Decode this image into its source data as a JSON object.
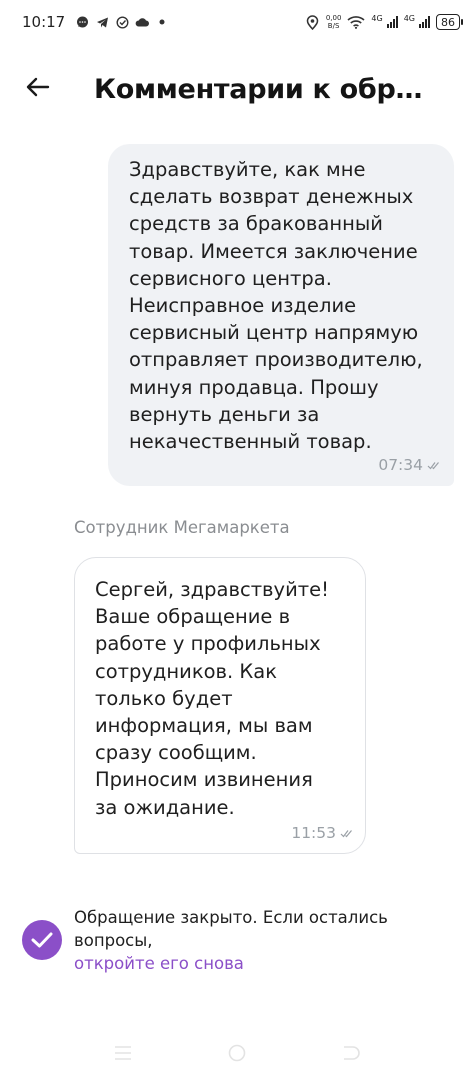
{
  "status_bar": {
    "time": "10:17",
    "net_speed_value": "0,00",
    "net_speed_unit": "B/S",
    "net_type_1": "4G",
    "net_type_2": "4G",
    "battery": "86",
    "icons": [
      "chat-icon",
      "telegram-icon",
      "check-circle-icon",
      "cloud-icon",
      "dot-icon",
      "location-icon",
      "wifi-icon",
      "signal-icon",
      "signal-icon",
      "battery-icon"
    ]
  },
  "header": {
    "title": "Комментарии к обращ…",
    "back_icon": "arrow-left-icon"
  },
  "messages": [
    {
      "direction": "outgoing",
      "text": "Здравствуйте, как мне\nсделать возврат денежных\nсредств за бракованный\nтовар. Имеется заключение\nсервисного центра.\nНеисправное изделие\nсервисный центр напрямую\nотправляет производителю,\nминуя продавца. Прошу\nвернуть деньги за\nнекачественный товар.",
      "time": "07:34",
      "status_icon": "double-check-icon"
    },
    {
      "direction": "incoming",
      "sender": "Сотрудник Мегамаркета",
      "text": "Сергей, здравствуйте!\nВаше обращение в\nработе у профильных\nсотрудников. Как\nтолько будет\nинформация, мы вам\nсразу сообщим.\nПриносим извинения\nза ожидание.",
      "time": "11:53",
      "status_icon": "double-check-icon"
    }
  ],
  "closed_notice": {
    "text": "Обращение закрыто. Если остались вопросы,",
    "link": "откройте его снова",
    "icon": "check-circle-icon"
  },
  "colors": {
    "accent": "#8b4fc8",
    "outgoing_bubble": "#f0f2f5",
    "muted_text": "#8a8d91"
  },
  "nav_bar": {
    "icons": [
      "menu-icon",
      "home-icon",
      "back-icon"
    ]
  }
}
